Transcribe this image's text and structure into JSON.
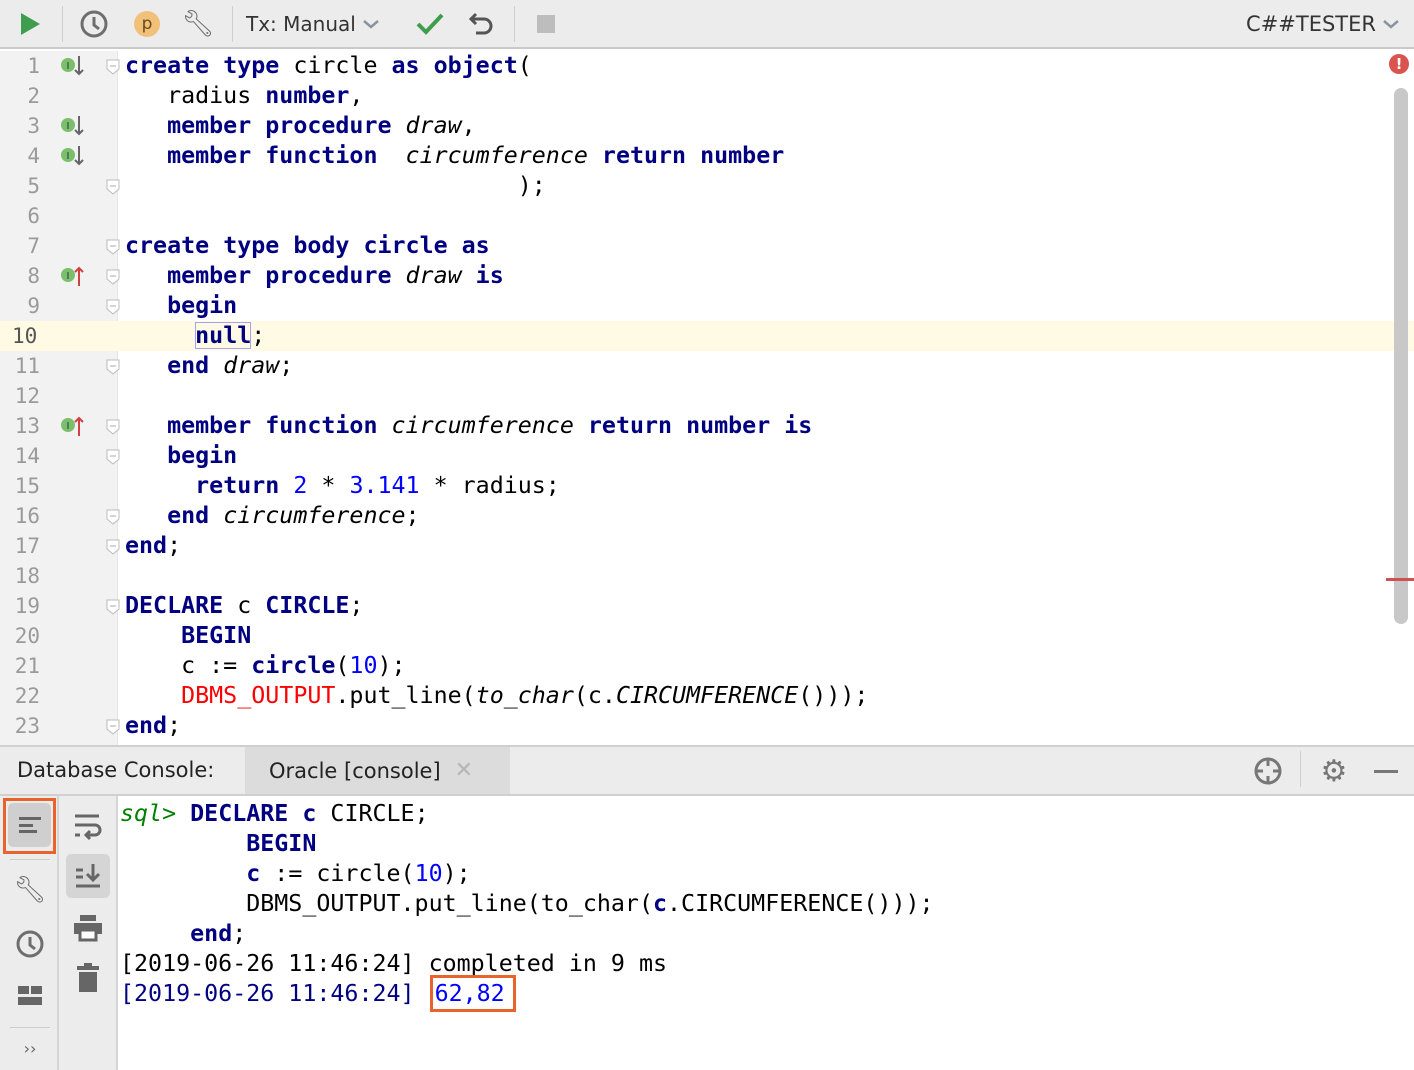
{
  "toolbar": {
    "tx_label": "Tx: Manual",
    "user_badge": "p",
    "schema_label": "C##TESTER",
    "colors": {
      "run": "#3e9e4d",
      "commit": "#3e9e4d",
      "badge": "#f2c179"
    }
  },
  "editor": {
    "current_line": 10,
    "gutter_icons": {
      "1": "implements-down",
      "3": "implements-down",
      "4": "implements-down",
      "8": "implemented-up",
      "13": "implemented-up"
    },
    "fold_lines": [
      1,
      5,
      7,
      8,
      9,
      11,
      13,
      14,
      16,
      17,
      19,
      23
    ],
    "lines": [
      [
        [
          "k",
          "create"
        ],
        [
          "t",
          " "
        ],
        [
          "k",
          "type"
        ],
        [
          "t",
          " circle "
        ],
        [
          "k",
          "as"
        ],
        [
          "t",
          " "
        ],
        [
          "k",
          "object"
        ],
        [
          "t",
          "("
        ]
      ],
      [
        [
          "t",
          "   radius "
        ],
        [
          "k",
          "number"
        ],
        [
          "t",
          ","
        ]
      ],
      [
        [
          "t",
          "   "
        ],
        [
          "k",
          "member"
        ],
        [
          "t",
          " "
        ],
        [
          "k",
          "procedure"
        ],
        [
          "t",
          " "
        ],
        [
          "i",
          "draw"
        ],
        [
          "t",
          ","
        ]
      ],
      [
        [
          "t",
          "   "
        ],
        [
          "k",
          "member"
        ],
        [
          "t",
          " "
        ],
        [
          "k",
          "function"
        ],
        [
          "t",
          "  "
        ],
        [
          "i",
          "circumference"
        ],
        [
          "t",
          " "
        ],
        [
          "k",
          "return"
        ],
        [
          "t",
          " "
        ],
        [
          "k",
          "number"
        ]
      ],
      [
        [
          "t",
          "                            );"
        ]
      ],
      [],
      [
        [
          "k",
          "create"
        ],
        [
          "t",
          " "
        ],
        [
          "k",
          "type"
        ],
        [
          "t",
          " "
        ],
        [
          "k",
          "body"
        ],
        [
          "t",
          " "
        ],
        [
          "k",
          "circle"
        ],
        [
          "t",
          " "
        ],
        [
          "k",
          "as"
        ]
      ],
      [
        [
          "t",
          "   "
        ],
        [
          "k",
          "member"
        ],
        [
          "t",
          " "
        ],
        [
          "k",
          "procedure"
        ],
        [
          "t",
          " "
        ],
        [
          "i",
          "draw"
        ],
        [
          "t",
          " "
        ],
        [
          "k",
          "is"
        ]
      ],
      [
        [
          "t",
          "   "
        ],
        [
          "k",
          "begin"
        ]
      ],
      [
        [
          "t",
          "     "
        ],
        [
          "kbox",
          "null"
        ],
        [
          "t",
          ";"
        ]
      ],
      [
        [
          "t",
          "   "
        ],
        [
          "k",
          "end"
        ],
        [
          "t",
          " "
        ],
        [
          "i",
          "draw"
        ],
        [
          "t",
          ";"
        ]
      ],
      [],
      [
        [
          "t",
          "   "
        ],
        [
          "k",
          "member"
        ],
        [
          "t",
          " "
        ],
        [
          "k",
          "function"
        ],
        [
          "t",
          " "
        ],
        [
          "i",
          "circumference"
        ],
        [
          "t",
          " "
        ],
        [
          "k",
          "return"
        ],
        [
          "t",
          " "
        ],
        [
          "k",
          "number"
        ],
        [
          "t",
          " "
        ],
        [
          "k",
          "is"
        ]
      ],
      [
        [
          "t",
          "   "
        ],
        [
          "k",
          "begin"
        ]
      ],
      [
        [
          "t",
          "     "
        ],
        [
          "k",
          "return"
        ],
        [
          "t",
          " "
        ],
        [
          "n",
          "2"
        ],
        [
          "t",
          " * "
        ],
        [
          "n",
          "3.141"
        ],
        [
          "t",
          " * radius;"
        ]
      ],
      [
        [
          "t",
          "   "
        ],
        [
          "k",
          "end"
        ],
        [
          "t",
          " "
        ],
        [
          "i",
          "circumference"
        ],
        [
          "t",
          ";"
        ]
      ],
      [
        [
          "k",
          "end"
        ],
        [
          "t",
          ";"
        ]
      ],
      [],
      [
        [
          "k",
          "DECLARE"
        ],
        [
          "t",
          " c "
        ],
        [
          "k",
          "CIRCLE"
        ],
        [
          "t",
          ";"
        ]
      ],
      [
        [
          "t",
          "    "
        ],
        [
          "k",
          "BEGIN"
        ]
      ],
      [
        [
          "t",
          "    c := "
        ],
        [
          "k",
          "circle"
        ],
        [
          "t",
          "("
        ],
        [
          "n",
          "10"
        ],
        [
          "t",
          ");"
        ]
      ],
      [
        [
          "t",
          "    "
        ],
        [
          "r",
          "DBMS_OUTPUT"
        ],
        [
          "t",
          ".put_line("
        ],
        [
          "i",
          "to_char"
        ],
        [
          "t",
          "(c."
        ],
        [
          "i",
          "CIRCUMFERENCE"
        ],
        [
          "t",
          "()));"
        ]
      ],
      [
        [
          "k",
          "end"
        ],
        [
          "t",
          ";"
        ]
      ]
    ]
  },
  "console_bar": {
    "label": "Database Console:",
    "tab": "Oracle [console]"
  },
  "console": {
    "highlight_color": "#e8642c",
    "lines": [
      [
        [
          "g",
          "sql>"
        ],
        [
          "t",
          " "
        ],
        [
          "k",
          "DECLARE"
        ],
        [
          "t",
          " "
        ],
        [
          "k",
          "c"
        ],
        [
          "t",
          " CIRCLE;"
        ]
      ],
      [
        [
          "t",
          "         "
        ],
        [
          "k",
          "BEGIN"
        ]
      ],
      [
        [
          "t",
          "         "
        ],
        [
          "k",
          "c"
        ],
        [
          "t",
          " := circle("
        ],
        [
          "n",
          "10"
        ],
        [
          "t",
          ");"
        ]
      ],
      [
        [
          "t",
          "         DBMS_OUTPUT.put_line(to_char("
        ],
        [
          "k",
          "c"
        ],
        [
          "t",
          ".CIRCUMFERENCE()));"
        ]
      ],
      [
        [
          "t",
          "     "
        ],
        [
          "k",
          "end"
        ],
        [
          "t",
          ";"
        ]
      ],
      [
        [
          "t",
          "[2019-06-26 11:46:24] completed in 9 ms"
        ]
      ],
      [
        [
          "b",
          "[2019-06-26 11:46:24] "
        ],
        [
          "result",
          "62,82"
        ]
      ]
    ]
  }
}
